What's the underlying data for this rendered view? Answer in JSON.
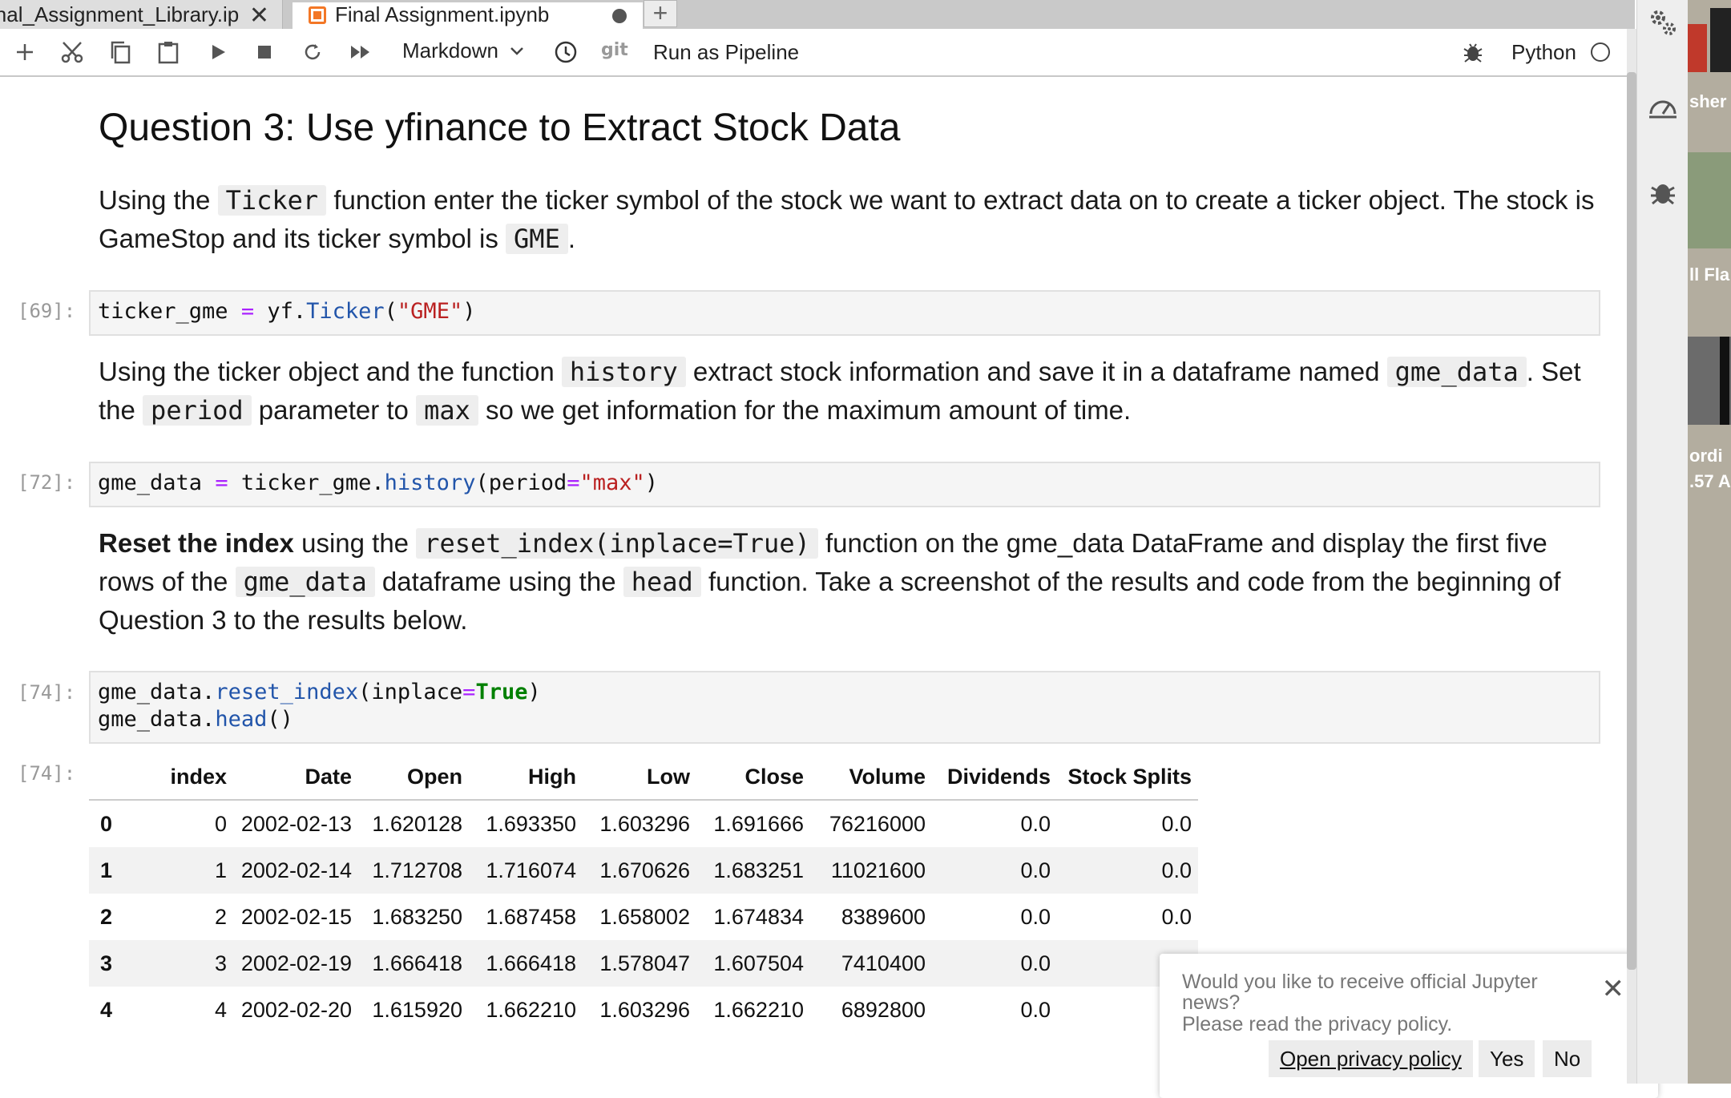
{
  "tabs": [
    {
      "label": "inal_Assignment_Library.ip"
    },
    {
      "label": "Final Assignment.ipynb"
    }
  ],
  "toolbar": {
    "cell_type": "Markdown",
    "git": "git",
    "run_pipeline": "Run as Pipeline",
    "kernel": "Python"
  },
  "notebook": {
    "heading": "Question 3: Use yfinance to Extract Stock Data",
    "md1": {
      "t1": "Using the ",
      "c1": "Ticker",
      "t2": " function enter the ticker symbol of the stock we want to extract data on to create a ticker object. The stock is GameStop and its ticker symbol is ",
      "c2": "GME",
      "t3": "."
    },
    "cell1": {
      "prompt": "[69]:",
      "p1": "ticker_gme ",
      "p2": "=",
      "p3": " yf.",
      "p4": "Ticker",
      "p5": "(",
      "p6": "\"GME\"",
      "p7": ")"
    },
    "md2": {
      "t1": "Using the ticker object and the function ",
      "c1": "history",
      "t2": " extract stock information and save it in a dataframe named ",
      "c2": "gme_data",
      "t3": ". Set the ",
      "c3": "period",
      "t4": " parameter to ",
      "c4": "max",
      "t5": " so we get information for the maximum amount of time."
    },
    "cell2": {
      "prompt": "[72]:",
      "p1": "gme_data ",
      "p2": "=",
      "p3": " ticker_gme.",
      "p4": "history",
      "p5": "(period",
      "p6": "=",
      "p7": "\"max\"",
      "p8": ")"
    },
    "md3": {
      "b1": "Reset the index",
      "t1": " using the ",
      "c1": "reset_index(inplace=True)",
      "t2": " function on the gme_data DataFrame and display the first five rows of the ",
      "c2": "gme_data",
      "t3": " dataframe using the ",
      "c3": "head",
      "t4": " function. Take a screenshot of the results and code from the beginning of Question 3 to the results below."
    },
    "cell3": {
      "prompt": "[74]:",
      "l1a": "gme_data.",
      "l1b": "reset_index",
      "l1c": "(inplace",
      "l1d": "=",
      "l1e": "True",
      "l1f": ")",
      "l2a": "gme_data.",
      "l2b": "head",
      "l2c": "()"
    },
    "output": {
      "prompt": "[74]:",
      "columns": [
        "index",
        "Date",
        "Open",
        "High",
        "Low",
        "Close",
        "Volume",
        "Dividends",
        "Stock Splits"
      ],
      "rows": [
        {
          "label": "0",
          "cells": [
            "0",
            "2002-02-13",
            "1.620128",
            "1.693350",
            "1.603296",
            "1.691666",
            "76216000",
            "0.0",
            "0.0"
          ]
        },
        {
          "label": "1",
          "cells": [
            "1",
            "2002-02-14",
            "1.712708",
            "1.716074",
            "1.670626",
            "1.683251",
            "11021600",
            "0.0",
            "0.0"
          ]
        },
        {
          "label": "2",
          "cells": [
            "2",
            "2002-02-15",
            "1.683250",
            "1.687458",
            "1.658002",
            "1.674834",
            "8389600",
            "0.0",
            "0.0"
          ]
        },
        {
          "label": "3",
          "cells": [
            "3",
            "2002-02-19",
            "1.666418",
            "1.666418",
            "1.578047",
            "1.607504",
            "7410400",
            "0.0",
            "0."
          ]
        },
        {
          "label": "4",
          "cells": [
            "4",
            "2002-02-20",
            "1.615920",
            "1.662210",
            "1.603296",
            "1.662210",
            "6892800",
            "0.0",
            "0."
          ]
        }
      ]
    }
  },
  "notification": {
    "message": "Would you like to receive official Jupyter news?",
    "message2": "Please read the privacy policy.",
    "privacy_button": "Open privacy policy",
    "yes": "Yes",
    "no": "No"
  },
  "desktop": {
    "t1": "sher",
    "t2": "ll Fla",
    "t3": "ordi",
    "t4": ".57 A"
  }
}
